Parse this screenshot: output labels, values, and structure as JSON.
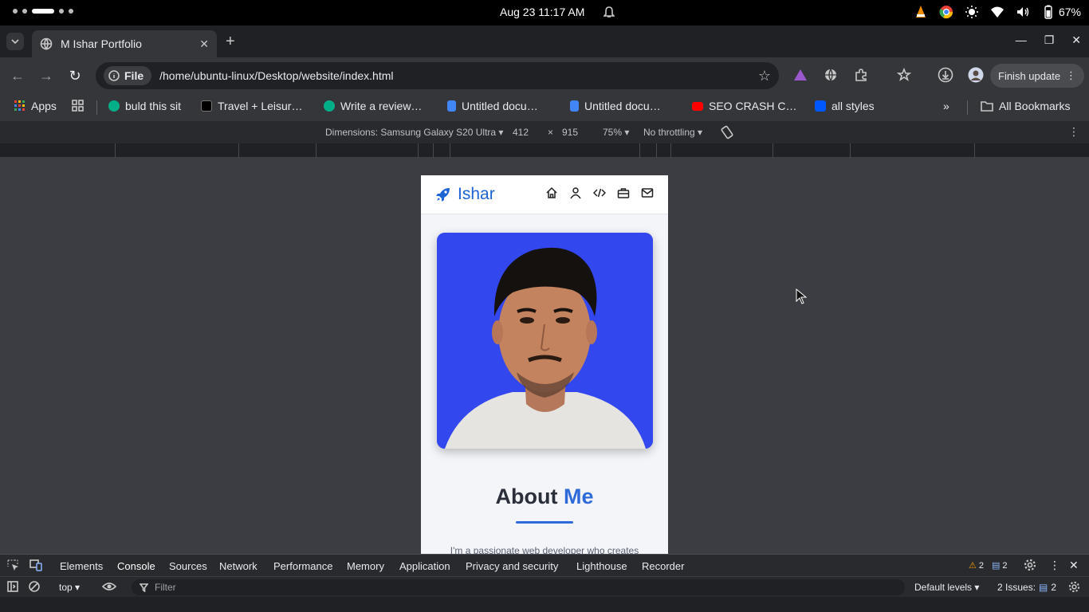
{
  "system_bar": {
    "datetime": "Aug 23  11:17 AM",
    "battery": "67%"
  },
  "browser": {
    "tab_title": "M Ishar Portfolio",
    "address_chip": "File",
    "url": "/home/ubuntu-linux/Desktop/website/index.html",
    "finish_update": "Finish update",
    "bookmarks": [
      {
        "label": "Apps",
        "color": "#ea4335"
      },
      {
        "label": "buld this sit",
        "color": "#00af87"
      },
      {
        "label": "Travel + Leisur…",
        "color": "#000000"
      },
      {
        "label": "Write a review…",
        "color": "#00af87"
      },
      {
        "label": "Untitled docu…",
        "color": "#4285f4"
      },
      {
        "label": "Untitled docu…",
        "color": "#4285f4"
      },
      {
        "label": "SEO CRASH C…",
        "color": "#ff0000"
      },
      {
        "label": "all styles",
        "color": "#0057ff"
      }
    ],
    "all_bookmarks": "All Bookmarks"
  },
  "device_toolbar": {
    "dimensions": "Dimensions: Samsung Galaxy S20 Ultra",
    "width": "412",
    "times": "×",
    "height": "915",
    "zoom": "75%",
    "throttling": "No throttling"
  },
  "site": {
    "brand": "Ishar",
    "about_heading": "About",
    "about_accent": "Me",
    "intro": "I'm a passionate web developer who creates"
  },
  "devtools": {
    "tabs": [
      "Elements",
      "Console",
      "Sources",
      "Network",
      "Performance",
      "Memory",
      "Application",
      "Privacy and security",
      "Lighthouse",
      "Recorder"
    ],
    "active_tab": "Console",
    "warnings_count": "2",
    "messages_count": "2",
    "context": "top",
    "filter_placeholder": "Filter",
    "levels": "Default levels",
    "issues": "2 Issues:",
    "issues_count": "2"
  },
  "colors": {
    "accent": "#2f6bd8",
    "photo_bg": "#3347ee"
  }
}
